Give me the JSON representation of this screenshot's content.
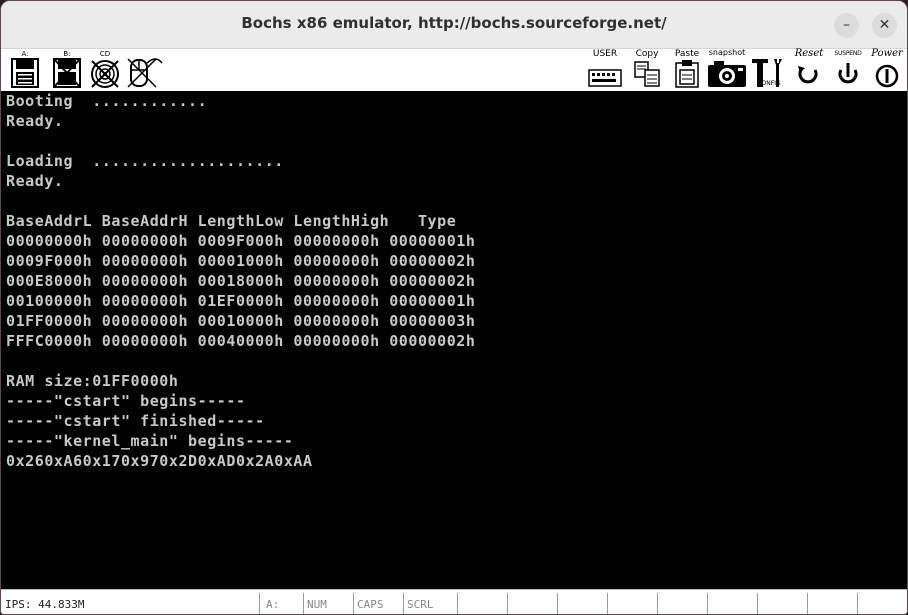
{
  "window": {
    "title": "Bochs x86 emulator, http://bochs.sourceforge.net/",
    "minimize_glyph": "–",
    "close_glyph": "✕"
  },
  "toolbar": {
    "floppy_a_label": "A:",
    "floppy_b_label": "B:",
    "cdrom_label": "CD",
    "user_label": "USER",
    "copy_label": "Copy",
    "paste_label": "Paste",
    "snapshot_label": "snapshot",
    "config_label": "CONFIG",
    "reset_label": "Reset",
    "suspend_label": "SUSPEND",
    "power_label": "Power"
  },
  "screen": {
    "lines": [
      "Booting  ............",
      "Ready.",
      "",
      "Loading  ....................",
      "Ready.",
      "",
      "BaseAddrL BaseAddrH LengthLow LengthHigh   Type",
      "00000000h 00000000h 0009F000h 00000000h 00000001h",
      "0009F000h 00000000h 00001000h 00000000h 00000002h",
      "000E8000h 00000000h 00018000h 00000000h 00000002h",
      "00100000h 00000000h 01EF0000h 00000000h 00000001h",
      "01FF0000h 00000000h 00010000h 00000000h 00000003h",
      "FFFC0000h 00000000h 00040000h 00000000h 00000002h",
      "",
      "RAM size:01FF0000h",
      "-----\"cstart\" begins-----",
      "-----\"cstart\" finished-----",
      "-----\"kernel_main\" begins-----",
      "0x260xA60x170x970x2D0xAD0x2A0xAA"
    ]
  },
  "statusbar": {
    "ips": "IPS: 44.833M",
    "drive": "A:",
    "num": "NUM",
    "caps": "CAPS",
    "scrl": "SCRL"
  }
}
